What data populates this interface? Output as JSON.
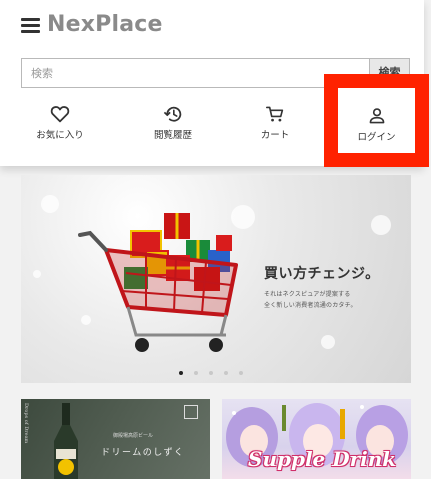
{
  "header": {
    "logo": "NexPlace",
    "search": {
      "placeholder": "検索",
      "button_label": "検索"
    },
    "nav": {
      "favorites": {
        "label": "お気に入り",
        "icon": "heart-icon"
      },
      "history": {
        "label": "閲覧履歴",
        "icon": "history-icon"
      },
      "cart": {
        "label": "カート",
        "icon": "cart-icon"
      },
      "login": {
        "label": "ログイン",
        "icon": "user-icon"
      }
    }
  },
  "highlight_color": "#ff2200",
  "banner": {
    "headline": "買い方チェンジ。",
    "subline1": "それはネクスピュアが提案する",
    "subline2": "全く新しい消費者流通のカタチ。",
    "carousel_active_index": 0,
    "carousel_count": 5
  },
  "thumbnails": {
    "item1": {
      "title": "ドリームのしずく",
      "caption": "御殿場高原ビール"
    },
    "item2": {
      "title": "Supple Drink"
    }
  }
}
